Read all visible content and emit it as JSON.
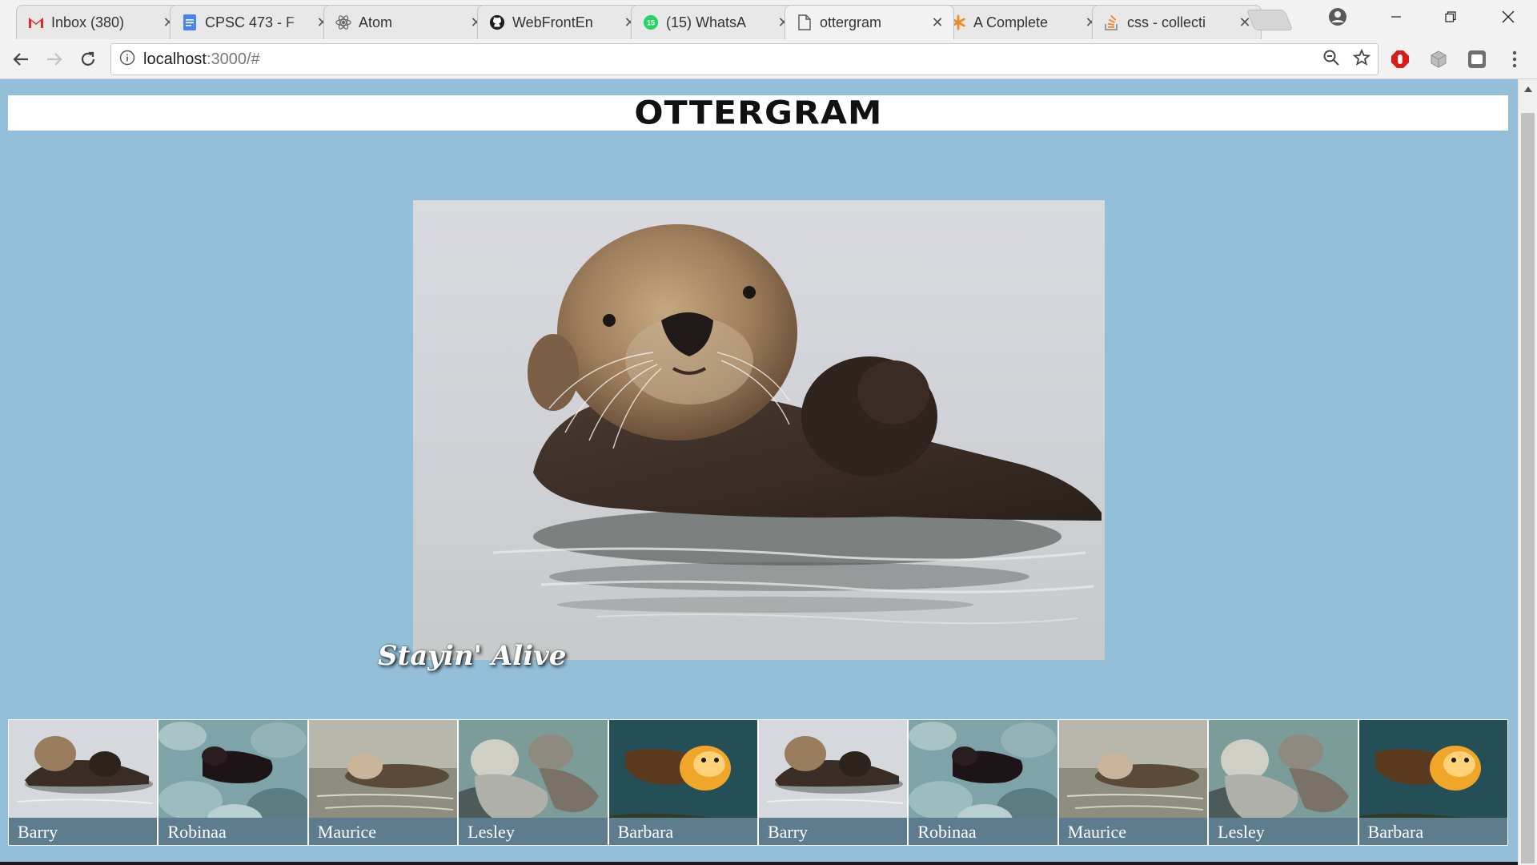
{
  "browser": {
    "tabs": [
      {
        "title": "Inbox (380)",
        "icon": "gmail-icon",
        "active": false
      },
      {
        "title": "CPSC 473 - F",
        "icon": "google-docs-icon",
        "active": false
      },
      {
        "title": "Atom",
        "icon": "atom-icon",
        "active": false
      },
      {
        "title": "WebFrontEn",
        "icon": "github-icon",
        "active": false
      },
      {
        "title": "(15) WhatsA",
        "icon": "whatsapp-icon",
        "active": false,
        "badge": "15"
      },
      {
        "title": "ottergram",
        "icon": "page-icon",
        "active": true
      },
      {
        "title": "A Complete",
        "icon": "asterisk-icon",
        "active": false
      },
      {
        "title": "css - collecti",
        "icon": "stackoverflow-icon",
        "active": false
      }
    ],
    "address_bar": {
      "host": "localhost",
      "rest": ":3000/#"
    }
  },
  "page": {
    "logo": "OTTERGRAM",
    "detail_title": "Stayin' Alive",
    "thumbnails": [
      {
        "label": "Barry",
        "scene": "float"
      },
      {
        "label": "Robinaa",
        "scene": "rocks"
      },
      {
        "label": "Maurice",
        "scene": "water"
      },
      {
        "label": "Lesley",
        "scene": "pair"
      },
      {
        "label": "Barbara",
        "scene": "kelp"
      },
      {
        "label": "Barry",
        "scene": "float"
      },
      {
        "label": "Robinaa",
        "scene": "rocks"
      },
      {
        "label": "Maurice",
        "scene": "water"
      },
      {
        "label": "Lesley",
        "scene": "pair"
      },
      {
        "label": "Barbara",
        "scene": "kelp"
      }
    ]
  },
  "colors": {
    "page_background": "#93bfd8",
    "thumb_label_background": "#5d7d8f"
  }
}
